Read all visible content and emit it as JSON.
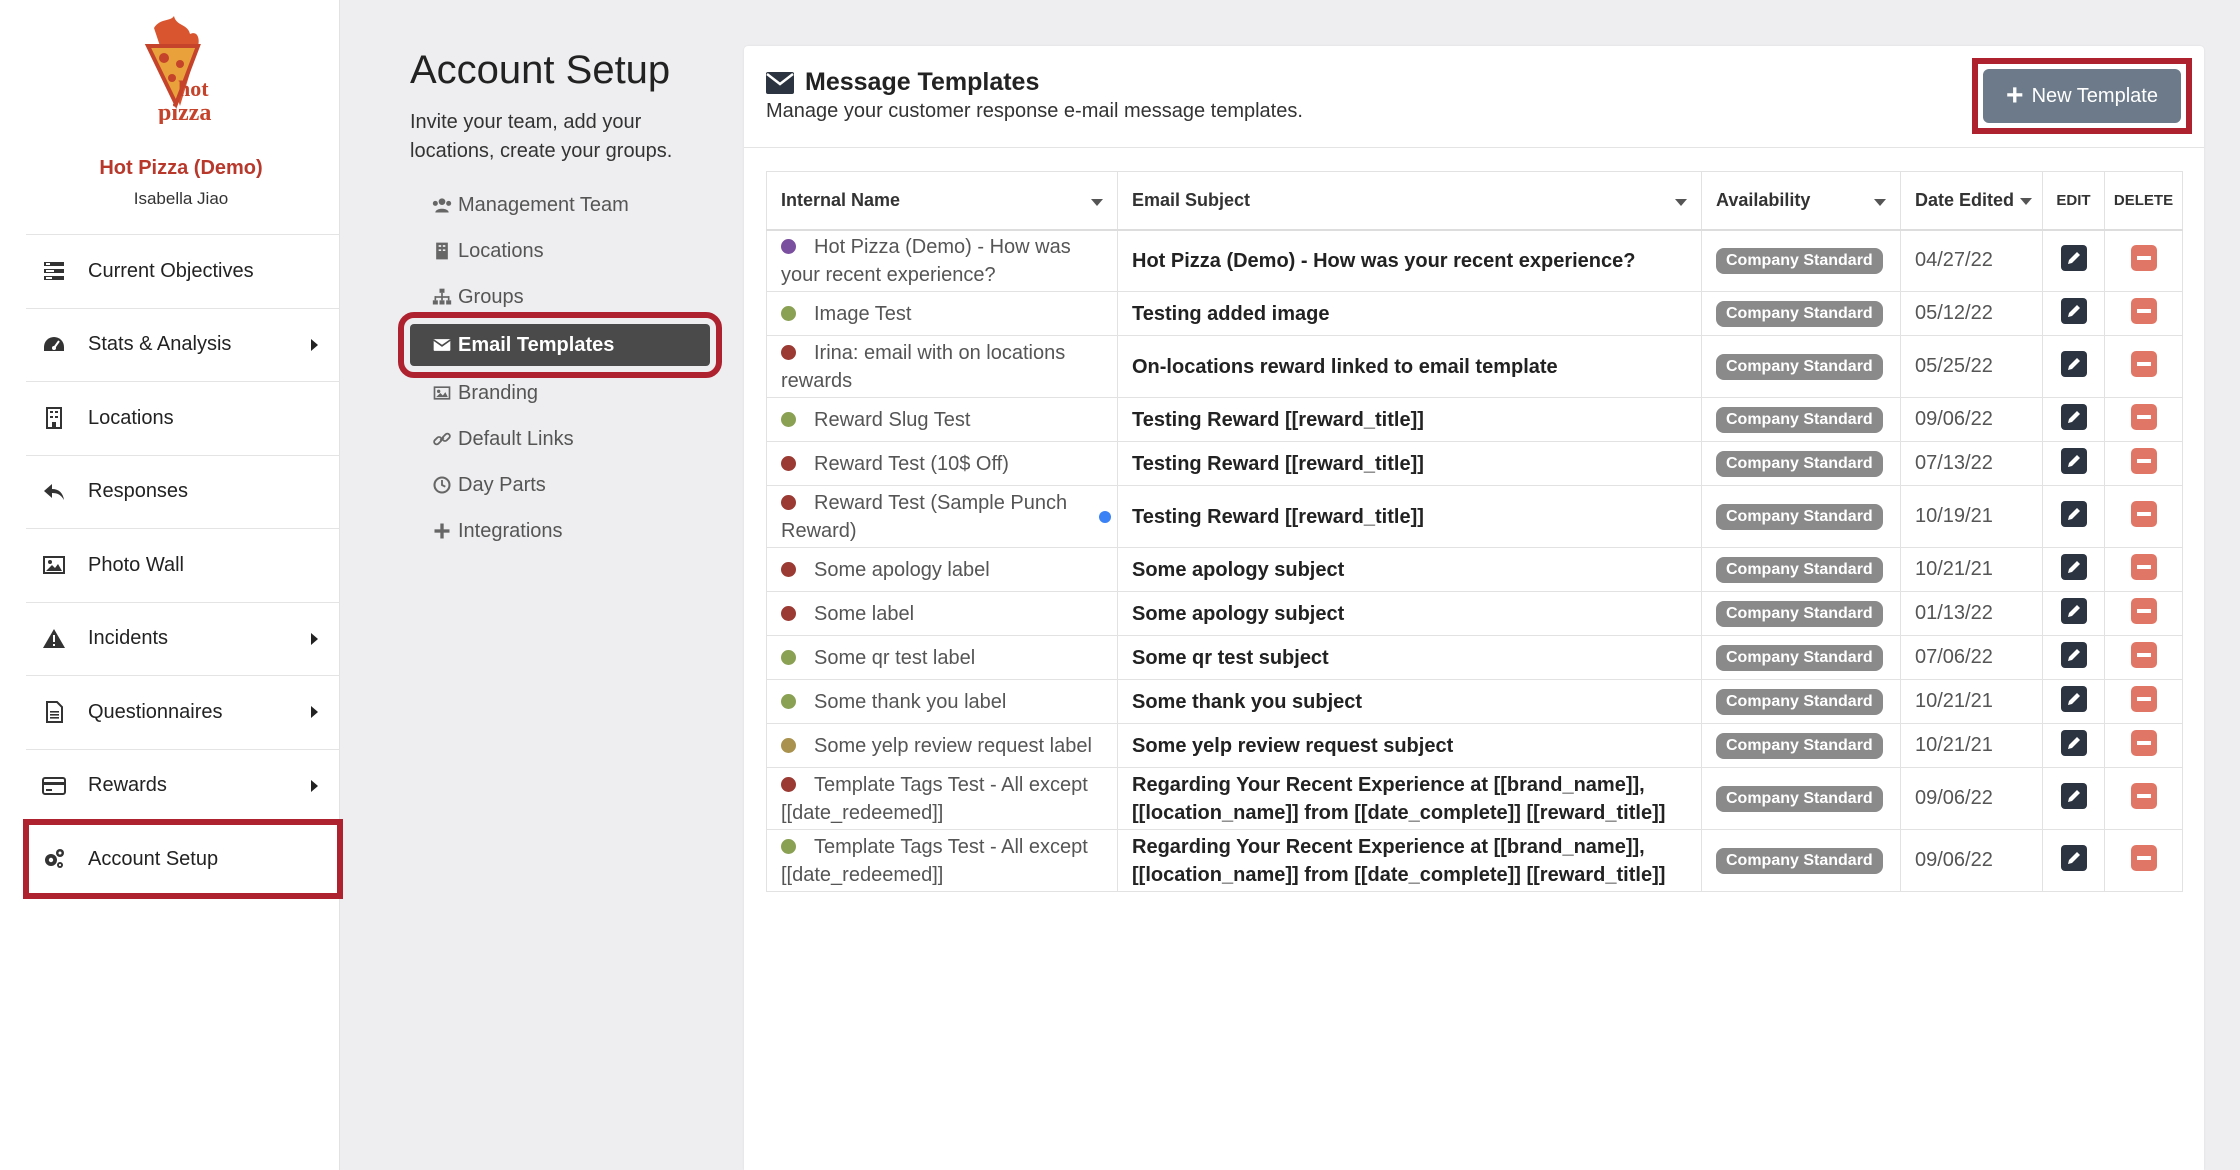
{
  "sidebar": {
    "brand_name": "Hot Pizza (Demo)",
    "user_name": "Isabella Jiao",
    "items": [
      {
        "label": "Current Objectives",
        "icon": "objectives-icon",
        "has_caret": false
      },
      {
        "label": "Stats & Analysis",
        "icon": "dashboard-icon",
        "has_caret": true
      },
      {
        "label": "Locations",
        "icon": "building-icon",
        "has_caret": false
      },
      {
        "label": "Responses",
        "icon": "reply-icon",
        "has_caret": false
      },
      {
        "label": "Photo Wall",
        "icon": "image-icon",
        "has_caret": false
      },
      {
        "label": "Incidents",
        "icon": "warning-icon",
        "has_caret": true
      },
      {
        "label": "Questionnaires",
        "icon": "document-icon",
        "has_caret": true
      },
      {
        "label": "Rewards",
        "icon": "credit-card-icon",
        "has_caret": true
      },
      {
        "label": "Account Setup",
        "icon": "gears-icon",
        "has_caret": false
      }
    ]
  },
  "setup": {
    "title": "Account Setup",
    "description": "Invite your team, add your locations, create your groups.",
    "items": [
      {
        "label": "Management Team",
        "icon": "users-icon"
      },
      {
        "label": "Locations",
        "icon": "building-icon"
      },
      {
        "label": "Groups",
        "icon": "sitemap-icon"
      },
      {
        "label": "Email Templates",
        "icon": "envelope-icon"
      },
      {
        "label": "Branding",
        "icon": "image-icon"
      },
      {
        "label": "Default Links",
        "icon": "link-icon"
      },
      {
        "label": "Day Parts",
        "icon": "clock-icon"
      },
      {
        "label": "Integrations",
        "icon": "plus-icon"
      }
    ]
  },
  "panel": {
    "title": "Message Templates",
    "subtitle": "Manage your customer response e-mail message templates.",
    "new_button": "New Template"
  },
  "table": {
    "headers": {
      "name": "Internal Name",
      "subject": "Email Subject",
      "availability": "Availability",
      "date": "Date Edited",
      "edit": "EDIT",
      "delete": "DELETE"
    },
    "rows": [
      {
        "dot": "#7b4fa0",
        "name": "Hot Pizza (Demo) - How was your recent experience?",
        "subject": "Hot Pizza (Demo) - How was your recent experience?",
        "availability": "Company Standard",
        "date": "04/27/22",
        "new": false
      },
      {
        "dot": "#8aa154",
        "name": "Image Test",
        "subject": "Testing added image",
        "availability": "Company Standard",
        "date": "05/12/22",
        "new": false
      },
      {
        "dot": "#9a3a33",
        "name": "Irina: email with on locations rewards",
        "subject": "On-locations reward linked to email template",
        "availability": "Company Standard",
        "date": "05/25/22",
        "new": false
      },
      {
        "dot": "#8aa154",
        "name": "Reward Slug Test",
        "subject": "Testing Reward [[reward_title]]",
        "availability": "Company Standard",
        "date": "09/06/22",
        "new": false
      },
      {
        "dot": "#9a3a33",
        "name": "Reward Test (10$ Off)",
        "subject": "Testing Reward [[reward_title]]",
        "availability": "Company Standard",
        "date": "07/13/22",
        "new": false
      },
      {
        "dot": "#9a3a33",
        "name": "Reward Test (Sample Punch Reward)",
        "subject": "Testing Reward [[reward_title]]",
        "availability": "Company Standard",
        "date": "10/19/21",
        "new": true
      },
      {
        "dot": "#9a3a33",
        "name": "Some apology label",
        "subject": "Some apology subject",
        "availability": "Company Standard",
        "date": "10/21/21",
        "new": false
      },
      {
        "dot": "#9a3a33",
        "name": "Some label",
        "subject": "Some apology subject",
        "availability": "Company Standard",
        "date": "01/13/22",
        "new": false
      },
      {
        "dot": "#8aa154",
        "name": "Some qr test label",
        "subject": "Some qr test subject",
        "availability": "Company Standard",
        "date": "07/06/22",
        "new": false
      },
      {
        "dot": "#8aa154",
        "name": "Some thank you label",
        "subject": "Some thank you subject",
        "availability": "Company Standard",
        "date": "10/21/21",
        "new": false
      },
      {
        "dot": "#a8924e",
        "name": "Some yelp review request label",
        "subject": "Some yelp review request subject",
        "availability": "Company Standard",
        "date": "10/21/21",
        "new": false
      },
      {
        "dot": "#9a3a33",
        "name": "Template Tags Test - All except [[date_redeemed]]",
        "subject": "Regarding Your Recent Experience at [[brand_name]], [[location_name]] from [[date_complete]] [[reward_title]]",
        "availability": "Company Standard",
        "date": "09/06/22",
        "new": false
      },
      {
        "dot": "#8aa154",
        "name": "Template Tags Test - All except [[date_redeemed]]",
        "subject": "Regarding Your Recent Experience at [[brand_name]], [[location_name]] from [[date_complete]] [[reward_title]]",
        "availability": "Company Standard",
        "date": "09/06/22",
        "new": false
      }
    ]
  },
  "colors": {
    "accent_red": "#ae2230",
    "brand_red": "#b8392c",
    "button_gray": "#6c7a8a",
    "delete_red": "#e07766"
  }
}
